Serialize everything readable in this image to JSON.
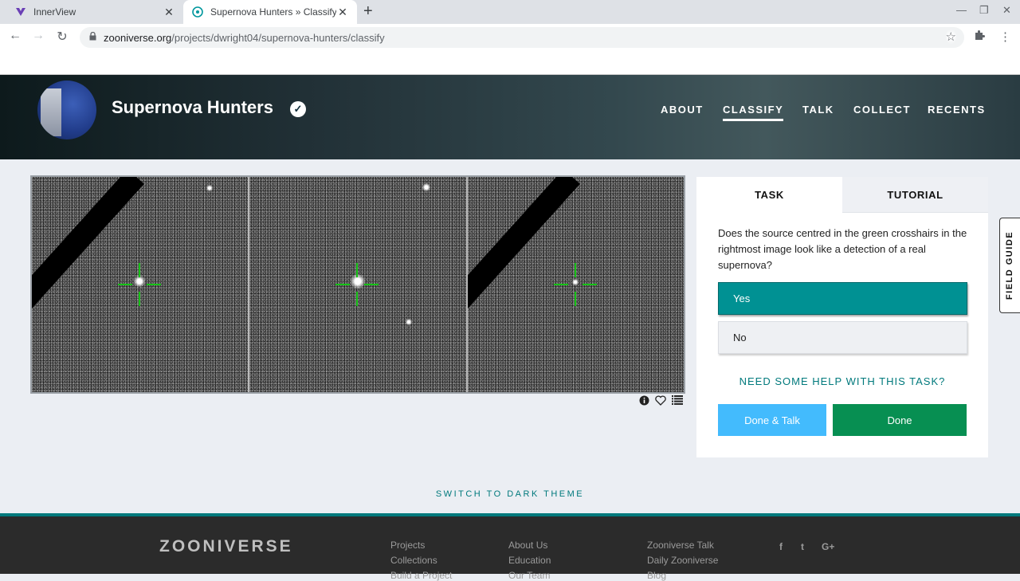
{
  "browser": {
    "tabs": [
      {
        "title": "InnerView",
        "close": "✕"
      },
      {
        "title": "Supernova Hunters » Classify — Z",
        "close": "✕"
      }
    ],
    "new_tab": "+",
    "window_controls": {
      "minimize": "—",
      "restore": "❐",
      "close": "✕"
    },
    "url_host": "zooniverse.org",
    "url_path": "/projects/dwright04/supernova-hunters/classify"
  },
  "project": {
    "title": "Supernova Hunters",
    "nav": [
      "ABOUT",
      "CLASSIFY",
      "TALK",
      "COLLECT",
      "RECENTS"
    ],
    "active_nav": "CLASSIFY"
  },
  "task_panel": {
    "tabs": [
      "TASK",
      "TUTORIAL"
    ],
    "question": "Does the source centred in the green crosshairs in the rightmost image look like a detection of a real supernova?",
    "answers": [
      "Yes",
      "No"
    ],
    "selected_answer": "Yes",
    "help_link": "NEED SOME HELP WITH THIS TASK?",
    "done_talk": "Done & Talk",
    "done": "Done"
  },
  "field_guide": "FIELD GUIDE",
  "theme_toggle": "SWITCH TO DARK THEME",
  "footer": {
    "logo": "ZOONIVERSE",
    "col1": [
      "Projects",
      "Collections",
      "Build a Project"
    ],
    "col2": [
      "About Us",
      "Education",
      "Our Team"
    ],
    "col3": [
      "Zooniverse Talk",
      "Daily Zooniverse",
      "Blog"
    ],
    "social": [
      "f",
      "t",
      "G+"
    ]
  },
  "colors": {
    "accent_teal": "#009193",
    "done_green": "#078f52",
    "done_talk_blue": "#43bbfd",
    "crosshair": "#15c215"
  },
  "icons": {
    "viewer_tools": [
      "info-icon",
      "heart-icon",
      "list-icon"
    ]
  }
}
